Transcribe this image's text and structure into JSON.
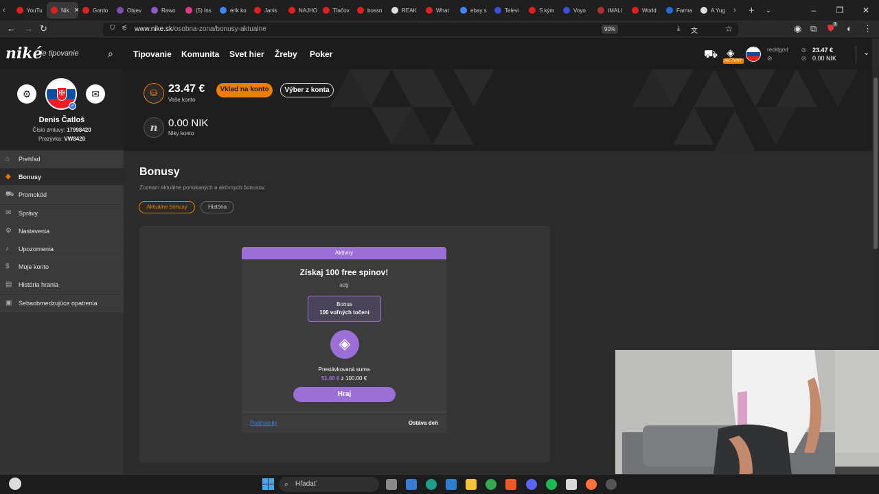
{
  "browser": {
    "tabs": [
      {
        "label": "YouTu",
        "color": "#e02020"
      },
      {
        "label": "Nik",
        "color": "#e02020",
        "active": true
      },
      {
        "label": "Gordo",
        "color": "#e02020"
      },
      {
        "label": "Objev",
        "color": "#7b4fa8"
      },
      {
        "label": "Rawo",
        "color": "#8a5ec4"
      },
      {
        "label": "(5) Ins",
        "color": "#d93a8a"
      },
      {
        "label": "erik ko",
        "color": "#4285f4"
      },
      {
        "label": "Janis",
        "color": "#e02020"
      },
      {
        "label": "NAJHO",
        "color": "#e02020"
      },
      {
        "label": "Tlačov",
        "color": "#e02020"
      },
      {
        "label": "bossn",
        "color": "#e02020"
      },
      {
        "label": "REAK",
        "color": "#dddddd"
      },
      {
        "label": "What",
        "color": "#e02020"
      },
      {
        "label": "ebay s",
        "color": "#4285f4"
      },
      {
        "label": "Televi",
        "color": "#3b4fd8"
      },
      {
        "label": "S kým",
        "color": "#e02020"
      },
      {
        "label": "Voyo",
        "color": "#3b4fd8"
      },
      {
        "label": "IMALI",
        "color": "#a33"
      },
      {
        "label": "World",
        "color": "#e02020"
      },
      {
        "label": "Farma",
        "color": "#2a6ad8"
      },
      {
        "label": "A Yug",
        "color": "#dddddd"
      }
    ],
    "url_domain": "www.nike.sk",
    "url_path": "/osobna-zona/bonusy-aktualne",
    "zoom": "90%",
    "ext_badge": "3"
  },
  "header": {
    "logo": "niké",
    "logo_sub": "je tipovanie",
    "nav": [
      "Tipovanie",
      "Komunita",
      "Svet hier",
      "Žreby",
      "Poker"
    ],
    "active_badge": "AKTÍVNY",
    "username": "recktgod",
    "balance": "23.47 €",
    "nik_balance": "0.00 NIK"
  },
  "profile": {
    "name": "Denis Čatloš",
    "contract_label": "Číslo zmluvy:",
    "contract_no": "17998420",
    "nick_label": "Prezývka:",
    "nick": "VW8420"
  },
  "sidebar": {
    "items": [
      {
        "label": "Prehľad",
        "icon": "home-icon"
      },
      {
        "label": "Bonusy",
        "icon": "diamond-icon",
        "active": true
      },
      {
        "label": "Promokód",
        "icon": "ticket-icon"
      },
      {
        "label": "Správy",
        "icon": "mail-icon"
      },
      {
        "label": "Nastavenia",
        "icon": "gear-icon"
      },
      {
        "label": "Upozornenia",
        "icon": "bell-icon"
      },
      {
        "label": "Moje konto",
        "icon": "dollar-icon"
      },
      {
        "label": "História hrania",
        "icon": "history-icon"
      },
      {
        "label": "Sebaobmedzujúce opatrenia",
        "icon": "limit-icon"
      }
    ]
  },
  "account": {
    "balance": "23.47 €",
    "balance_label": "Vaše konto",
    "deposit_btn": "Vklad na konto",
    "withdraw_btn": "Výber z konta",
    "nik": "0.00 NIK",
    "nik_label": "Niky konto"
  },
  "bonusy": {
    "title": "Bonusy",
    "subtitle": "Zoznam aktuálne ponúkaných a aktívnych bonusov.",
    "tabs": [
      "Aktuálne bonusy",
      "História"
    ],
    "card": {
      "status": "Aktívny",
      "title": "Získaj 100 free spinov!",
      "desc": "adg",
      "bonus_label": "Bonus",
      "bonus_value": "100 voľných točení",
      "wager_label": "Prestávkovaná suma",
      "wager_current": "51.60 €",
      "wager_sep": "z",
      "wager_total": "100.00 €",
      "play_btn": "Hraj",
      "terms": "Podmienky",
      "remaining": "Ostáva deň"
    }
  },
  "taskbar": {
    "search_placeholder": "Hľadať"
  },
  "colors": {
    "accent_orange": "#f07d00",
    "accent_purple": "#9c6fd6"
  }
}
